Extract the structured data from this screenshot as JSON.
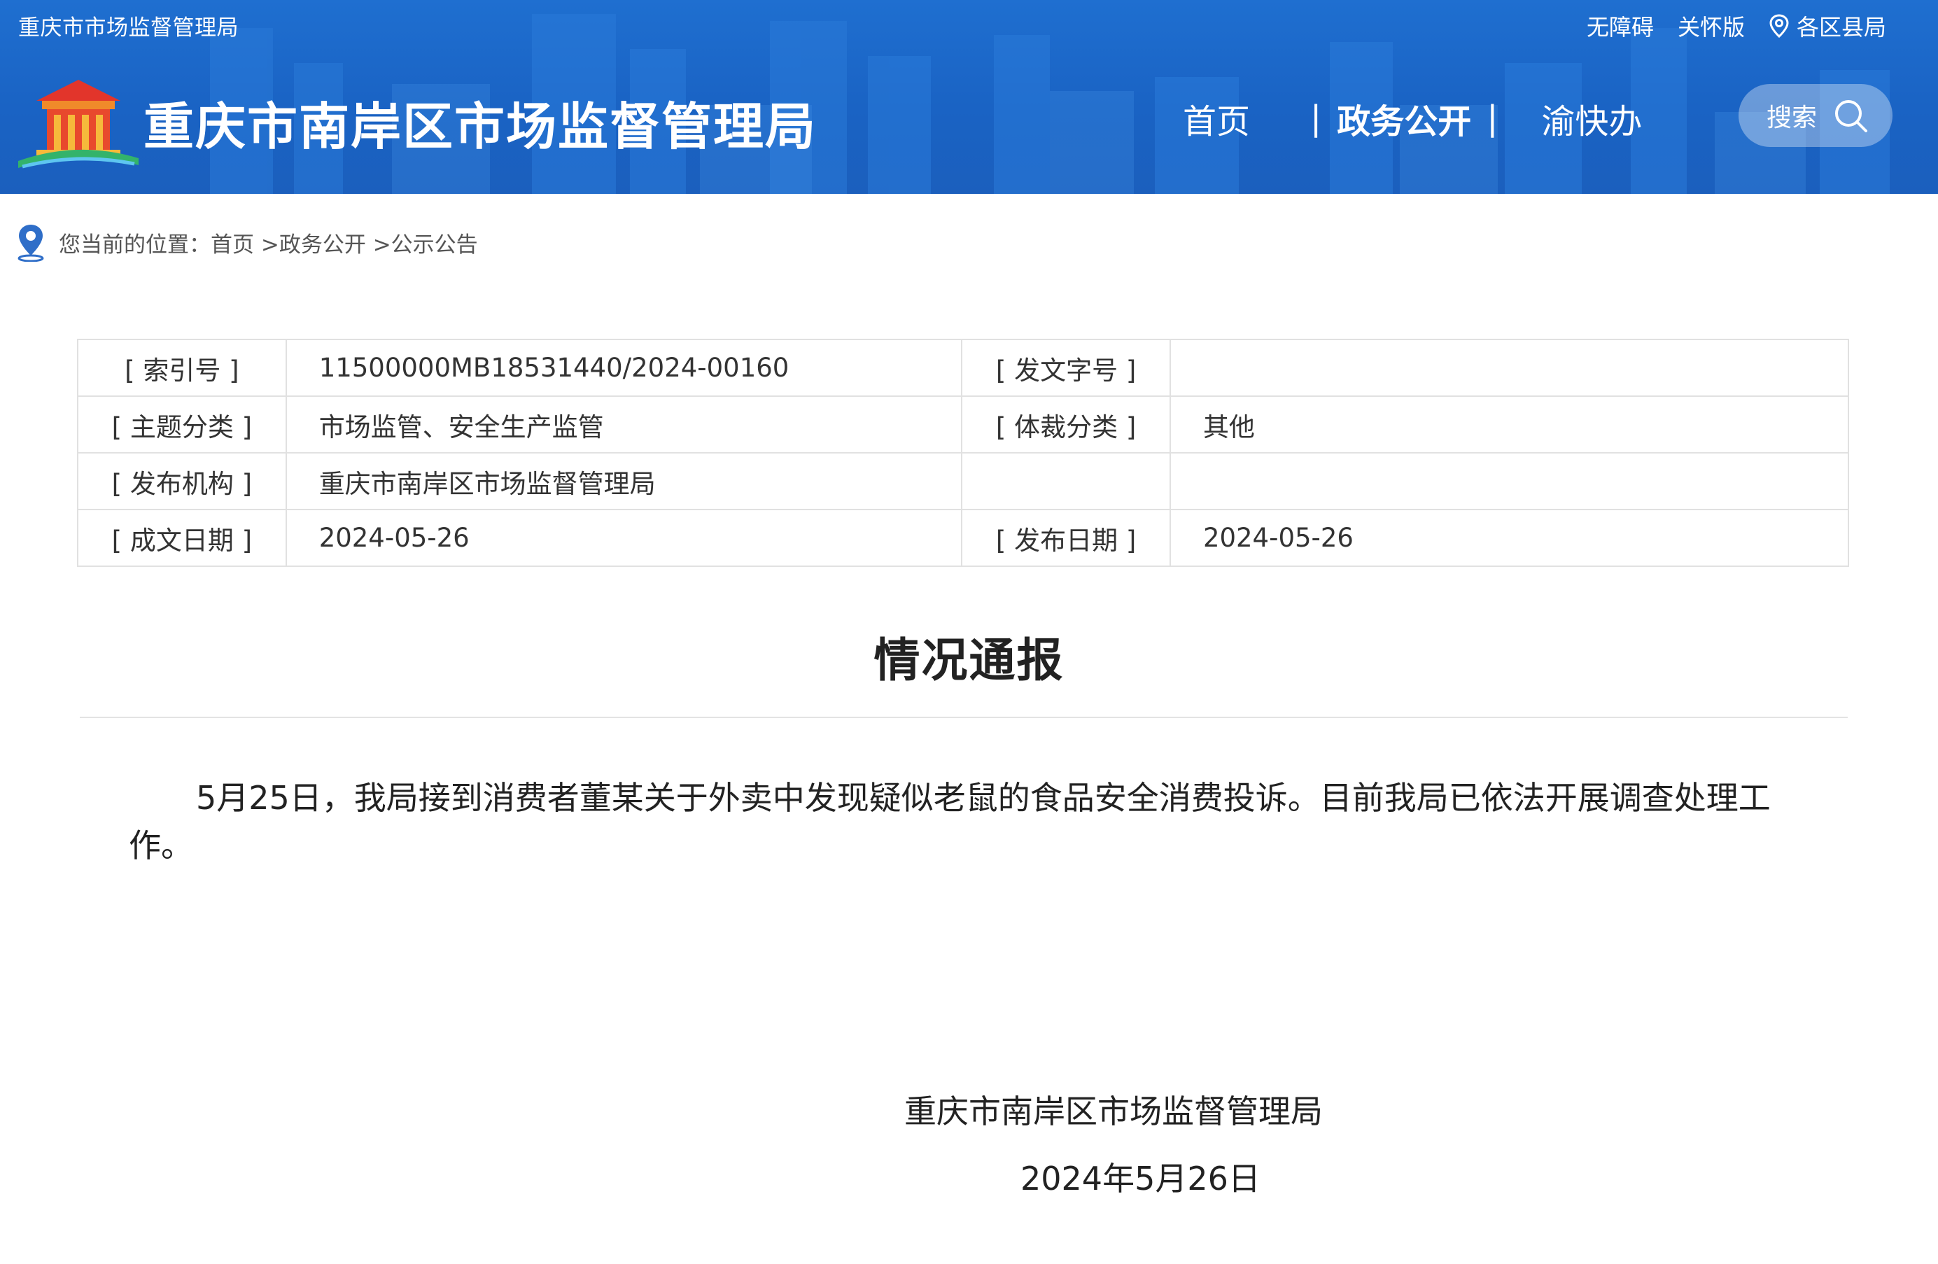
{
  "header": {
    "top_site_name": "重庆市市场监督管理局",
    "top_links": {
      "accessibility": "无障碍",
      "care_version": "关怀版",
      "districts": "各区县局"
    },
    "site_title": "重庆市南岸区市场监督管理局",
    "nav": {
      "home": "首页",
      "gov_open": "政务公开",
      "yu_kuai_ban": "渝快办"
    },
    "nav_separator": "|",
    "search_label": "搜索",
    "colors": {
      "header_bg": "#1b63c5",
      "text": "#ffffff"
    }
  },
  "breadcrumb": {
    "prefix": "您当前的位置：",
    "items": [
      "首页",
      " >政务公开",
      " >公示公告"
    ]
  },
  "info": {
    "rows": [
      {
        "label1": "[ 索引号 ]",
        "value1": "11500000MB18531440/2024-00160",
        "label2": "[ 发文字号 ]",
        "value2": ""
      },
      {
        "label1": "[ 主题分类 ]",
        "value1": "市场监管、安全生产监管",
        "label2": "[ 体裁分类 ]",
        "value2": "其他"
      },
      {
        "label1": "[ 发布机构 ]",
        "value1": "重庆市南岸区市场监督管理局",
        "label2": "",
        "value2": ""
      },
      {
        "label1": "[ 成文日期 ]",
        "value1": "2024-05-26",
        "label2": "[ 发布日期 ]",
        "value2": "2024-05-26"
      }
    ]
  },
  "article": {
    "title": "情况通报",
    "body": "5月25日，我局接到消费者董某关于外卖中发现疑似老鼠的食品安全消费投诉。目前我局已依法开展调查处理工作。",
    "signature_org": "重庆市南岸区市场监督管理局",
    "signature_date": "2024年5月26日"
  }
}
